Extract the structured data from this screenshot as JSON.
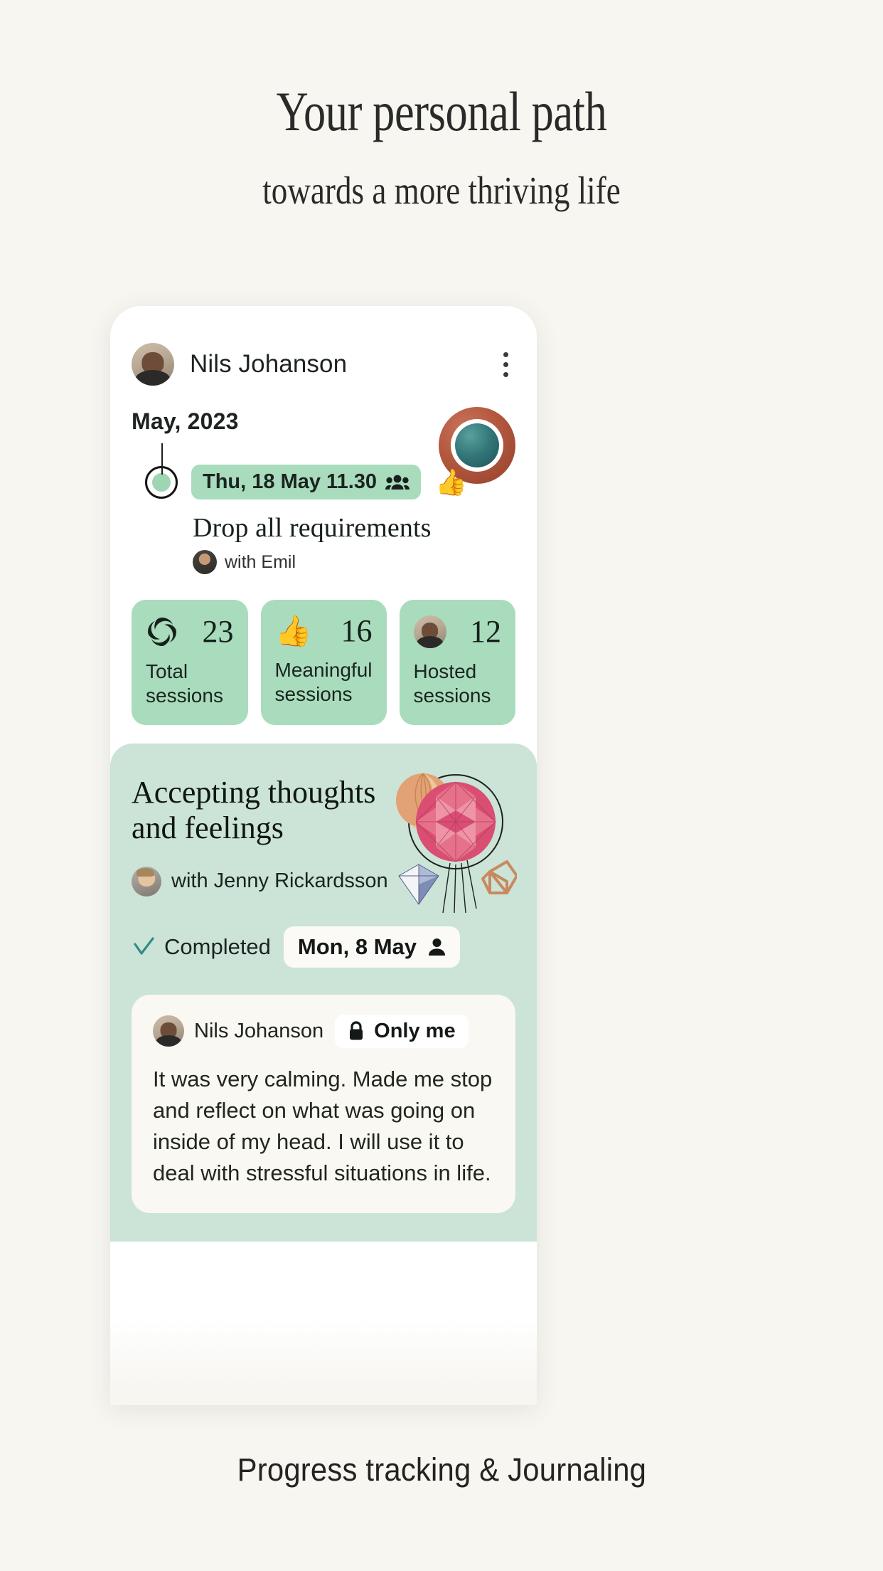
{
  "hero": {
    "headline": "Your personal path",
    "subheadline": "towards a more thriving life"
  },
  "footer": {
    "caption": "Progress tracking & Journaling"
  },
  "colors": {
    "page_background": "#f7f6f1",
    "card_background": "#ffffff",
    "accent_green": "#a8dcbd",
    "section_green": "#cce3d8",
    "journal_background": "#faf8f2",
    "orb_outer": "#b4593f",
    "orb_inner": "#33767a",
    "check_teal": "#2f8c86",
    "text_dark": "#1d2320"
  },
  "card": {
    "profile": {
      "name": "Nils Johanson",
      "avatar_icon": "user-photo-avatar",
      "menu_icon": "kebab-menu-icon"
    },
    "month_label": "May, 2023",
    "timeline_entry": {
      "dot_icon": "timeline-dot-icon",
      "date_pill": "Thu, 18 May 11.30",
      "date_pill_icon": "people-group-icon",
      "reaction_emoji": "👍",
      "title": "Drop all requirements",
      "with_label": "with Emil",
      "with_avatar_icon": "user-photo-avatar"
    },
    "orb_icon": "decorative-orb-graphic",
    "stats": [
      {
        "icon": "swirl-logo-icon",
        "icon_type": "swirl",
        "value": "23",
        "label": "Total\nsessions",
        "label_line1": "Total",
        "label_line2": "sessions"
      },
      {
        "icon": "thumbs-up-emoji",
        "icon_type": "emoji",
        "emoji": "👍",
        "value": "16",
        "label_line1": "Meaningful",
        "label_line2": "sessions"
      },
      {
        "icon": "user-photo-avatar",
        "icon_type": "avatar",
        "value": "12",
        "label_line1": "Hosted",
        "label_line2": "sessions"
      }
    ]
  },
  "lesson": {
    "title_line1": "Accepting thoughts",
    "title_line2": "and feelings",
    "host_avatar_icon": "user-photo-avatar",
    "host_label": "with Jenny Rickardsson",
    "decoration_icon": "geometric-paper-shapes-illustration",
    "status": {
      "check_icon": "check-icon",
      "label": "Completed",
      "date_pill": "Mon, 8 May",
      "date_pill_icon": "person-icon"
    }
  },
  "journal": {
    "author_avatar_icon": "user-photo-avatar",
    "author": "Nils Johanson",
    "visibility_icon": "lock-icon",
    "visibility": "Only me",
    "body": "It was very calming. Made me stop and reflect on what was going on inside of my head. I will use it to deal with stressful situations in life."
  }
}
